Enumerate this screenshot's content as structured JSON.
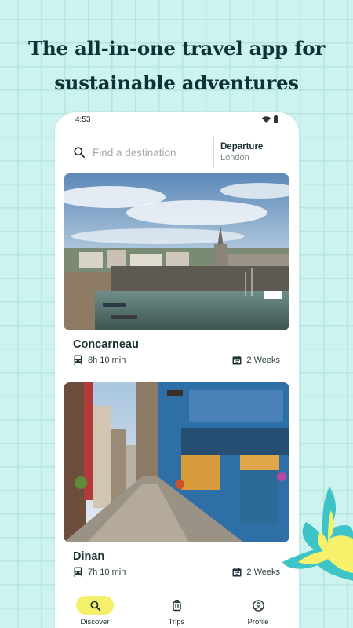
{
  "headline": {
    "line1": "The all-in-one travel app for",
    "line2": "sustainable adventures"
  },
  "status_bar": {
    "time": "4:53",
    "icons": [
      "wifi-icon",
      "battery-icon"
    ]
  },
  "search": {
    "placeholder": "Find a destination",
    "departure_label": "Departure",
    "departure_value": "London"
  },
  "cards": [
    {
      "title": "Concarneau",
      "travel_time": "8h 10 min",
      "duration": "2 Weeks",
      "transport_icon": "train-icon",
      "calendar_icon": "calendar-icon"
    },
    {
      "title": "Dinan",
      "travel_time": "7h 10 min",
      "duration": "2 Weeks",
      "transport_icon": "train-icon",
      "calendar_icon": "calendar-icon"
    }
  ],
  "bottom_nav": [
    {
      "label": "Discover",
      "icon": "search-icon",
      "active": true
    },
    {
      "label": "Trips",
      "icon": "luggage-icon",
      "active": false
    },
    {
      "label": "Profile",
      "icon": "profile-icon",
      "active": false
    }
  ],
  "colors": {
    "background": "#cdf3ef",
    "grid": "#b6e6e1",
    "headline": "#0f3237",
    "active_nav": "#f4f069",
    "flower_teal": "#3ec4c6",
    "flower_yellow": "#f6f06a"
  }
}
